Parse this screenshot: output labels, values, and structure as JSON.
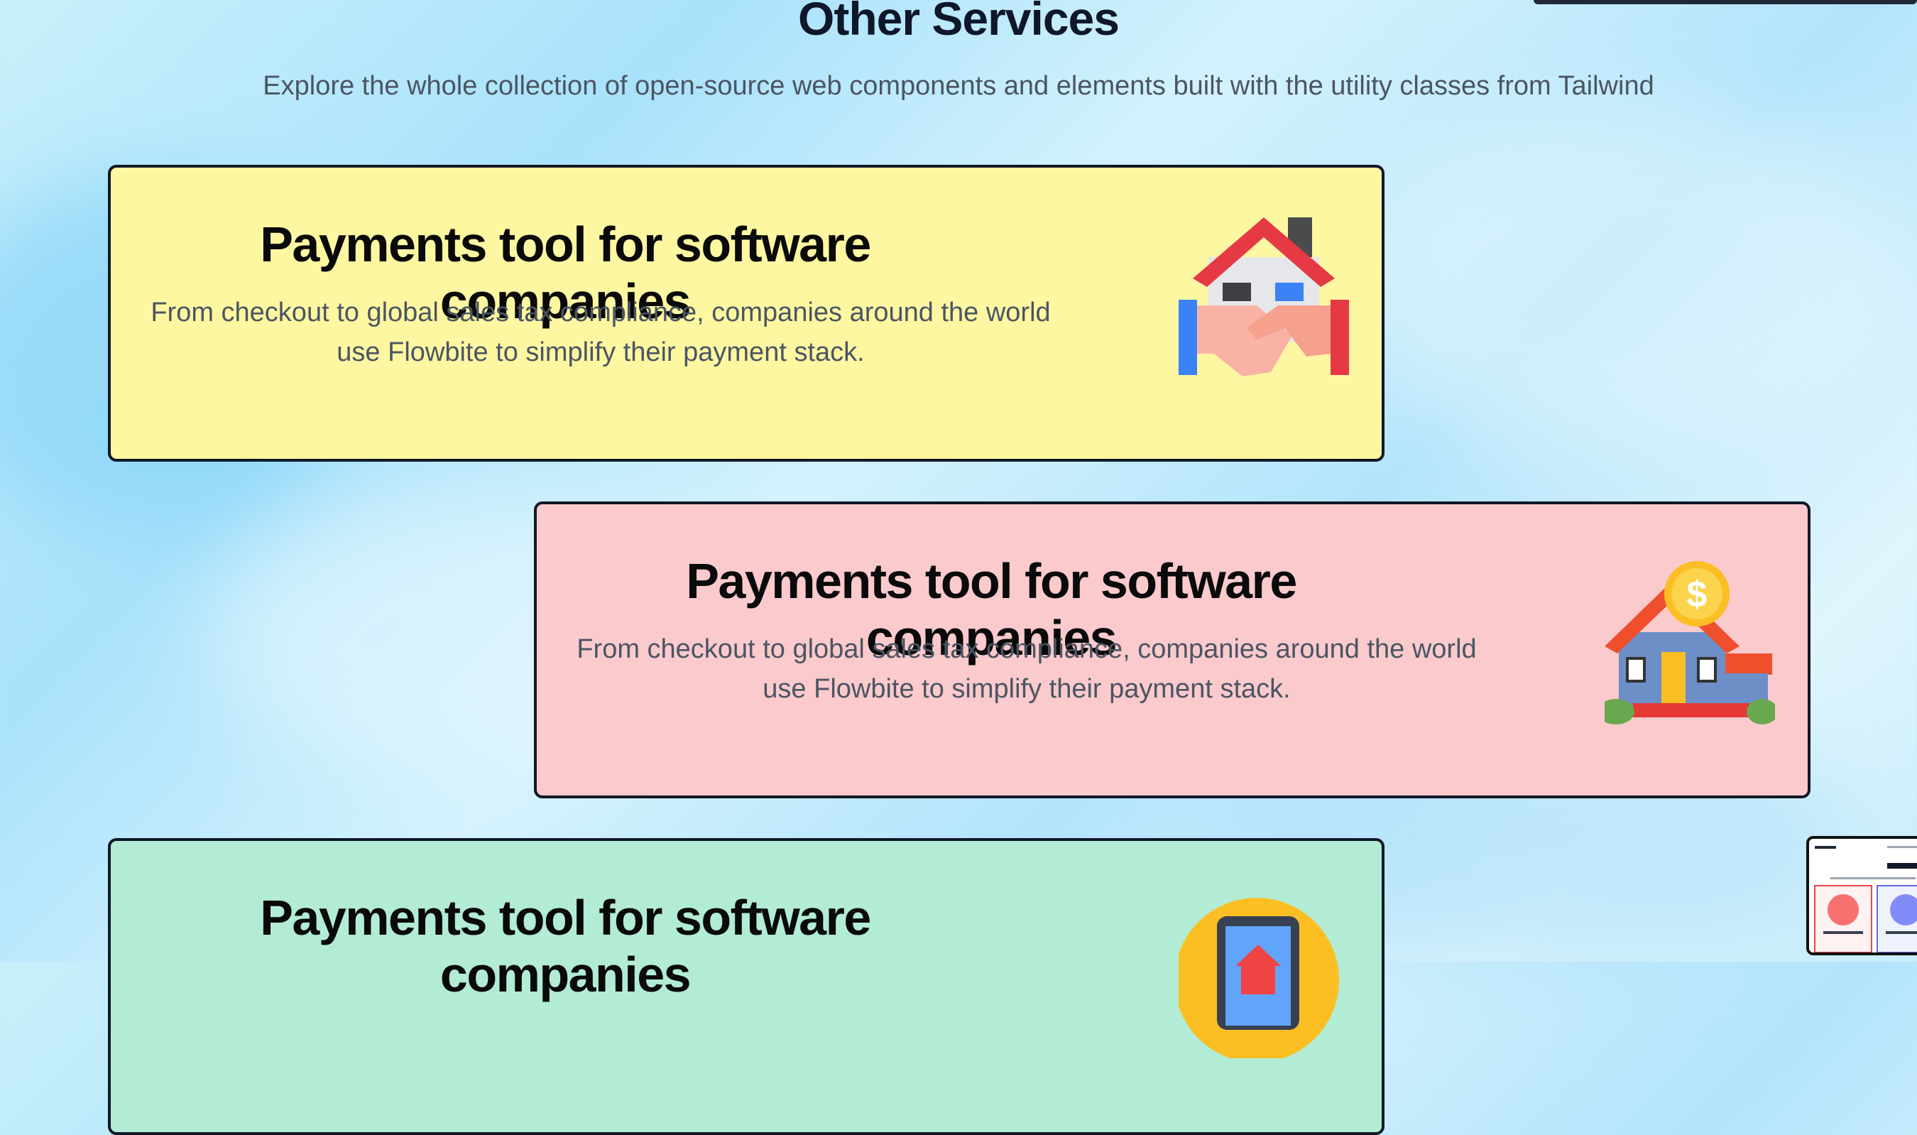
{
  "page": {
    "title": "Other Services",
    "subtitle": "Explore the whole collection of open-source web components and elements built with the utility classes from Tailwind"
  },
  "cards": [
    {
      "title": "Payments tool for software companies",
      "description": "From checkout to global sales tax compliance, companies around the world use Flowbite to simplify their payment stack.",
      "background": "#fef7a1",
      "icon": "house-handshake-icon"
    },
    {
      "title": "Payments tool for software companies",
      "description": "From checkout to global sales tax compliance, companies around the world use Flowbite to simplify their payment stack.",
      "background": "#fbcacd",
      "icon": "house-dollar-icon"
    },
    {
      "title": "Payments tool for software companies",
      "description": "",
      "background": "#b2ecd4",
      "icon": "tablet-house-icon"
    }
  ],
  "thumbnail": {
    "icon": "page-preview-icon"
  }
}
